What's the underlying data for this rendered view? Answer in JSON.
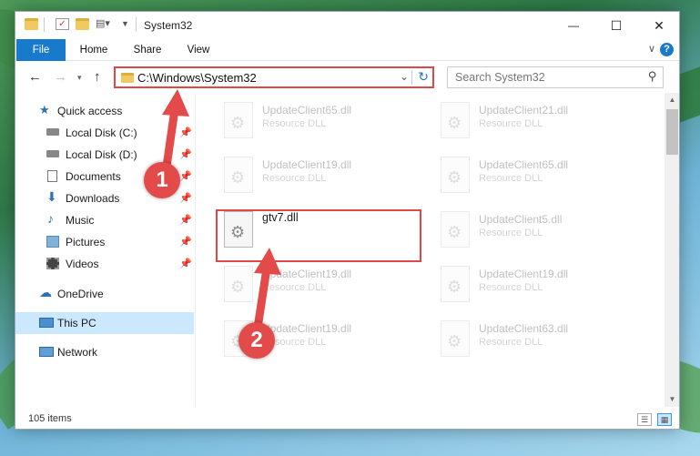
{
  "window": {
    "title": "System32",
    "controls": {
      "minimize": "—",
      "maximize": "☐",
      "close": "✕"
    }
  },
  "ribbon": {
    "tabs": [
      "File",
      "Home",
      "Share",
      "View"
    ],
    "help": "?"
  },
  "address_bar": {
    "path": "C:\\Windows\\System32",
    "search_placeholder": "Search System32"
  },
  "sidebar": {
    "items": [
      {
        "label": "Quick access",
        "icon": "star-icon"
      },
      {
        "label": "Local Disk (C:)",
        "icon": "drive-icon",
        "pinned": true
      },
      {
        "label": "Local Disk (D:)",
        "icon": "drive-icon",
        "pinned": true
      },
      {
        "label": "Documents",
        "icon": "documents-icon",
        "pinned": true
      },
      {
        "label": "Downloads",
        "icon": "download-icon",
        "pinned": true
      },
      {
        "label": "Music",
        "icon": "music-icon",
        "pinned": true
      },
      {
        "label": "Pictures",
        "icon": "pictures-icon",
        "pinned": true
      },
      {
        "label": "Videos",
        "icon": "videos-icon",
        "pinned": true
      },
      {
        "label": "OneDrive",
        "icon": "cloud-icon"
      },
      {
        "label": "This PC",
        "icon": "computer-icon",
        "selected": true
      },
      {
        "label": "Network",
        "icon": "network-icon"
      }
    ]
  },
  "files": [
    {
      "name": "UpdateClient65.dll",
      "type": "Resource DLL",
      "faded": true
    },
    {
      "name": "UpdateClient21.dll",
      "type": "Resource DLL",
      "faded": true
    },
    {
      "name": "UpdateClient19.dll",
      "type": "Resource DLL",
      "faded": true
    },
    {
      "name": "UpdateClient65.dll",
      "type": "Resource DLL",
      "faded": true
    },
    {
      "name": "gtv7.dll",
      "type": "",
      "faded": false,
      "highlighted": true
    },
    {
      "name": "UpdateClient5.dll",
      "type": "Resource DLL",
      "faded": true
    },
    {
      "name": "UpdateClient19.dll",
      "type": "Resource DLL",
      "faded": true
    },
    {
      "name": "UpdateClient19.dll",
      "type": "Resource DLL",
      "faded": true
    },
    {
      "name": "UpdateClient19.dll",
      "type": "Resource DLL",
      "faded": true
    },
    {
      "name": "UpdateClient63.dll",
      "type": "Resource DLL",
      "faded": true
    }
  ],
  "status": {
    "item_count": "105 items"
  },
  "callouts": {
    "one": "1",
    "two": "2"
  },
  "colors": {
    "accent": "#1979ca",
    "highlight": "#e04848",
    "selected": "#cce8ff"
  }
}
